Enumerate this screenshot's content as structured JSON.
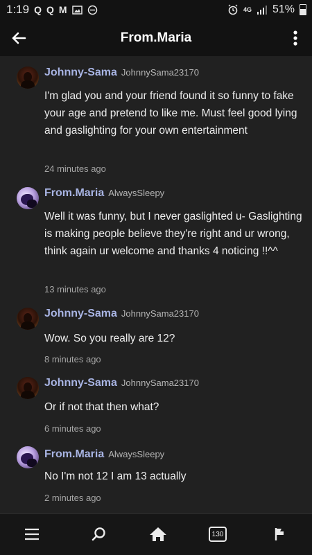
{
  "status_bar": {
    "time": "1:19",
    "notification_icons": [
      "Q",
      "Q",
      "M"
    ],
    "network_label": "4G",
    "battery_percent": "51%"
  },
  "app_bar": {
    "title": "From.Maria"
  },
  "messages": [
    {
      "author": "Johnny-Sama",
      "handle": "JohnnySama23170",
      "text": "I'm glad you and your friend found it so funny to fake your age and pretend to like me. Must feel good lying and gaslighting for your own entertainment",
      "time": "24 minutes ago"
    },
    {
      "author": "From.Maria",
      "handle": "AlwaysSleepy",
      "text": "Well it was funny, but I never gaslighted u- Gaslighting is making people believe they're right and ur wrong, think again ur welcome and thanks 4 noticing !!^^",
      "time": "13 minutes ago"
    },
    {
      "author": "Johnny-Sama",
      "handle": "JohnnySama23170",
      "text": "Wow. So you really are 12?",
      "time": "8 minutes ago"
    },
    {
      "author": "Johnny-Sama",
      "handle": "JohnnySama23170",
      "text": "Or if not that then what?",
      "time": "6 minutes ago"
    },
    {
      "author": "From.Maria",
      "handle": "AlwaysSleepy",
      "text": "No I'm not 12 I am 13 actually",
      "time": "2 minutes ago"
    }
  ],
  "bottom_nav": {
    "notifications_count": "130",
    "items": [
      "menu-icon",
      "search-icon",
      "home-icon",
      "notifications-badge",
      "flag-icon"
    ]
  },
  "colors": {
    "background": "#212121",
    "bar": "#121212",
    "author": "#a8b4e3",
    "text": "#ececec",
    "muted": "#a5a5a5"
  }
}
